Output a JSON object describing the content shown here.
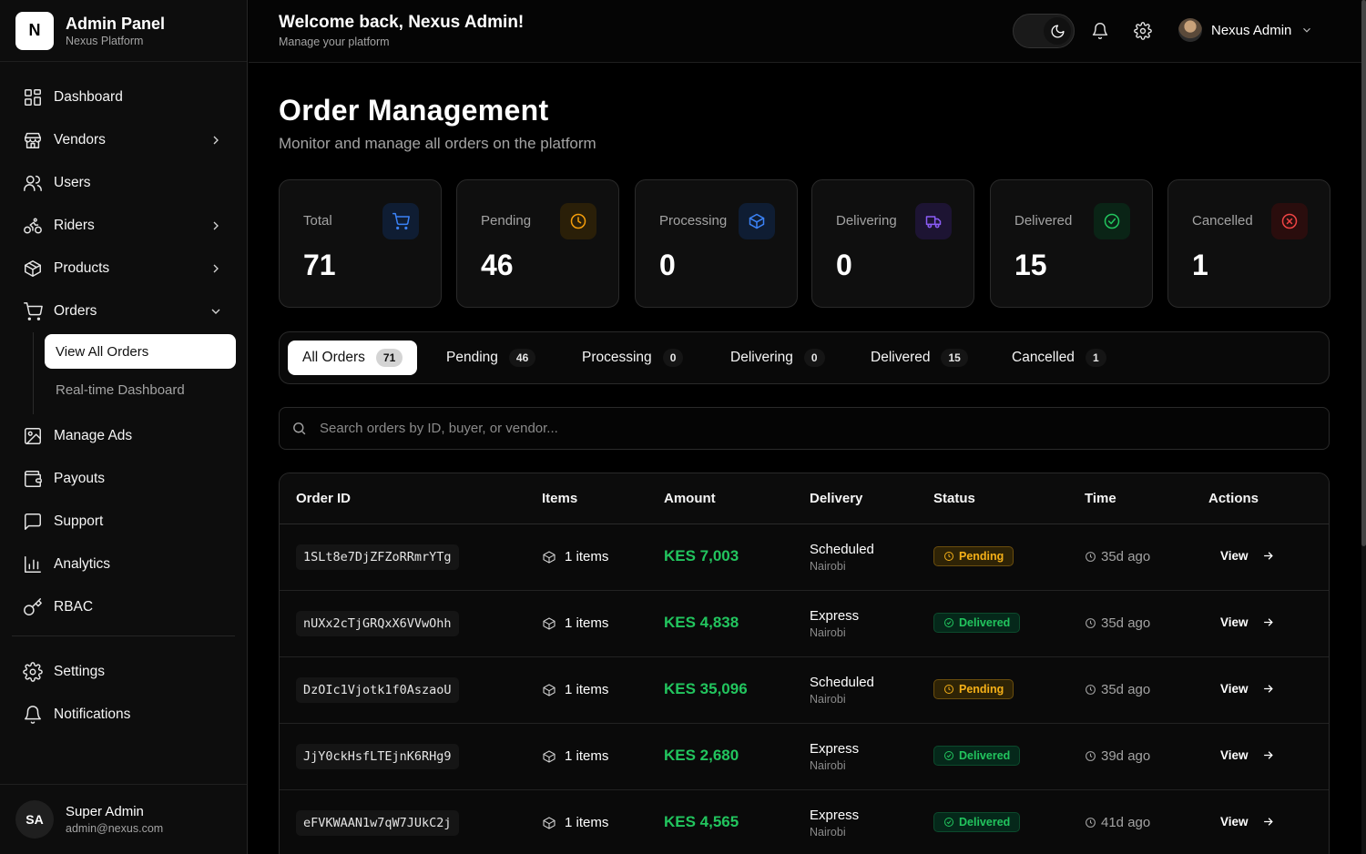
{
  "brand": {
    "logo": "N",
    "title": "Admin Panel",
    "subtitle": "Nexus Platform"
  },
  "sidebar": {
    "items": [
      {
        "label": "Dashboard",
        "icon": "grid-icon"
      },
      {
        "label": "Vendors",
        "icon": "store-icon",
        "expandable": true
      },
      {
        "label": "Users",
        "icon": "users-icon"
      },
      {
        "label": "Riders",
        "icon": "bike-icon",
        "expandable": true
      },
      {
        "label": "Products",
        "icon": "box-icon",
        "expandable": true
      },
      {
        "label": "Orders",
        "icon": "cart-icon",
        "expanded": true
      },
      {
        "label": "Manage Ads",
        "icon": "image-icon"
      },
      {
        "label": "Payouts",
        "icon": "wallet-icon"
      },
      {
        "label": "Support",
        "icon": "message-icon"
      },
      {
        "label": "Analytics",
        "icon": "chart-icon"
      },
      {
        "label": "RBAC",
        "icon": "key-icon"
      }
    ],
    "orders_sub": [
      {
        "label": "View All Orders",
        "active": true
      },
      {
        "label": "Real-time Dashboard",
        "active": false
      }
    ],
    "bottom_items": [
      {
        "label": "Settings",
        "icon": "settings-icon"
      },
      {
        "label": "Notifications",
        "icon": "bell-icon"
      }
    ],
    "user": {
      "initials": "SA",
      "name": "Super Admin",
      "email": "admin@nexus.com"
    }
  },
  "header": {
    "title": "Welcome back, Nexus Admin!",
    "subtitle": "Manage your platform",
    "user_name": "Nexus Admin"
  },
  "page": {
    "title": "Order Management",
    "subtitle": "Monitor and manage all orders on the platform"
  },
  "stats": [
    {
      "label": "Total",
      "value": "71",
      "icon": "cart-icon",
      "color": "#3b82f6",
      "bg": "#0f1d33"
    },
    {
      "label": "Pending",
      "value": "46",
      "icon": "clock-icon",
      "color": "#f59e0b",
      "bg": "#2a1f08"
    },
    {
      "label": "Processing",
      "value": "0",
      "icon": "box-icon",
      "color": "#3b82f6",
      "bg": "#0f1d33"
    },
    {
      "label": "Delivering",
      "value": "0",
      "icon": "truck-icon",
      "color": "#8b5cf6",
      "bg": "#1d1433"
    },
    {
      "label": "Delivered",
      "value": "15",
      "icon": "check-circle-icon",
      "color": "#22c55e",
      "bg": "#0a2416"
    },
    {
      "label": "Cancelled",
      "value": "1",
      "icon": "x-circle-icon",
      "color": "#ef4444",
      "bg": "#2a0d0d"
    }
  ],
  "tabs": [
    {
      "label": "All Orders",
      "count": "71",
      "active": true
    },
    {
      "label": "Pending",
      "count": "46"
    },
    {
      "label": "Processing",
      "count": "0"
    },
    {
      "label": "Delivering",
      "count": "0"
    },
    {
      "label": "Delivered",
      "count": "15"
    },
    {
      "label": "Cancelled",
      "count": "1"
    }
  ],
  "search": {
    "placeholder": "Search orders by ID, buyer, or vendor..."
  },
  "table": {
    "headers": [
      "Order ID",
      "Items",
      "Amount",
      "Delivery",
      "Status",
      "Time",
      "Actions"
    ],
    "rows": [
      {
        "id": "1SLt8e7DjZFZoRRmrYTg",
        "items": "1 items",
        "amount": "KES 7,003",
        "delivery": "Scheduled",
        "location": "Nairobi",
        "status": "Pending",
        "time": "35d ago",
        "action": "View"
      },
      {
        "id": "nUXx2cTjGRQxX6VVwOhh",
        "items": "1 items",
        "amount": "KES 4,838",
        "delivery": "Express",
        "location": "Nairobi",
        "status": "Delivered",
        "time": "35d ago",
        "action": "View"
      },
      {
        "id": "DzOIc1Vjotk1f0AszaoU",
        "items": "1 items",
        "amount": "KES 35,096",
        "delivery": "Scheduled",
        "location": "Nairobi",
        "status": "Pending",
        "time": "35d ago",
        "action": "View"
      },
      {
        "id": "JjY0ckHsfLTEjnK6RHg9",
        "items": "1 items",
        "amount": "KES 2,680",
        "delivery": "Express",
        "location": "Nairobi",
        "status": "Delivered",
        "time": "39d ago",
        "action": "View"
      },
      {
        "id": "eFVKWAAN1w7qW7JUkC2j",
        "items": "1 items",
        "amount": "KES 4,565",
        "delivery": "Express",
        "location": "Nairobi",
        "status": "Delivered",
        "time": "41d ago",
        "action": "View"
      }
    ]
  }
}
